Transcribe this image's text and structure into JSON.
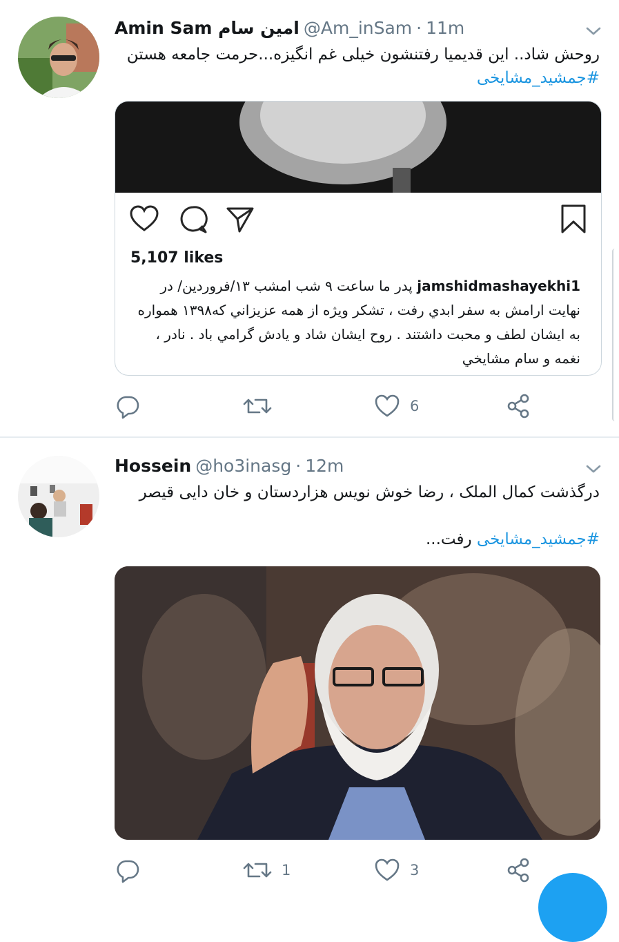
{
  "tweets": [
    {
      "display_name": "Amin Sam امین سام",
      "handle": "@Am_inSam",
      "separator": "·",
      "time": "11m",
      "text": "روحش شاد.. این قدیمیا رفتنشون خیلی غم انگیزه...حرمت جامعه هستن",
      "hashtag": "#جمشید_مشایخی",
      "card": {
        "likes": "5,107 likes",
        "username": "jamshidmashayekhi1",
        "caption": "پدر ما ساعت ۹ شب امشب ۱۳/فروردين/ در نهايت ارامش به سفر ابدي رفت ، تشكر ويژه از همه عزيزاني كه١٣٩٨ همواره به ايشان لطف و محبت داشتند . روح ايشان شاد و يادش گرامي باد . نادر ، نغمه و سام مشايخي"
      },
      "counts": {
        "reply": "",
        "retweet": "",
        "like": "6"
      }
    },
    {
      "display_name": "Hossein",
      "handle": "@ho3inasg",
      "separator": "·",
      "time": "12m",
      "text_line1": "درگذشت کمال الملک ، رضا خوش نویس هزاردستان و خان دایی قیصر",
      "hashtag": "#جمشید_مشایخی",
      "text_line2_suffix": " رفت...",
      "counts": {
        "reply": "",
        "retweet": "1",
        "like": "3"
      }
    }
  ],
  "icons": {
    "reply": "reply-icon",
    "retweet": "retweet-icon",
    "like": "heart-icon",
    "share": "share-icon",
    "menu": "chevron-down-icon",
    "ig_like": "instagram-heart-icon",
    "ig_comment": "instagram-comment-icon",
    "ig_share": "instagram-share-icon",
    "ig_save": "instagram-bookmark-icon"
  },
  "colors": {
    "link": "#1b95e0",
    "secondary": "#657786",
    "primary": "#14171a",
    "fab": "#1da1f2"
  }
}
